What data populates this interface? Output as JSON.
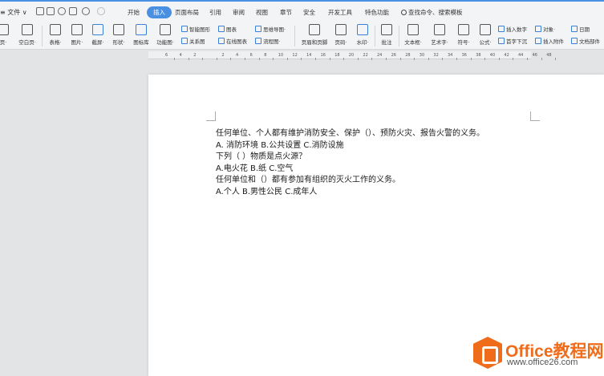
{
  "titlebar": {
    "file_menu": "≡ 文件 ∨",
    "tabs": [
      "开始",
      "插入",
      "页面布局",
      "引用",
      "审阅",
      "视图",
      "章节",
      "安全",
      "开发工具",
      "特色功能"
    ],
    "active_tab": "插入",
    "search_hint": "查找命令、搜索模板"
  },
  "ribbon": {
    "page_btn": "页·",
    "blank_page": "空白页·",
    "table": "表格·",
    "picture": "图片·",
    "screenshot": "截屏·",
    "shape": "形状·",
    "icon_lib": "图标库",
    "func_chart": "功能图·",
    "smart_shape": "智能图形",
    "relation": "关系图",
    "chart": "图表",
    "online_chart": "在线图表",
    "mind_map": "思维导图·",
    "flow_chart": "流程图·",
    "header_footer": "页眉和页脚",
    "page_num": "页码·",
    "watermark": "水印·",
    "comment": "批注",
    "textbox": "文本框·",
    "wordart": "艺术字·",
    "symbol": "符号·",
    "formula": "公式·",
    "insert_number": "插入数字",
    "drop_cap": "首字下沉",
    "object": "对象·",
    "attachment": "插入附件",
    "date": "日期",
    "doc_parts": "文档部件"
  },
  "ruler": {
    "labels": [
      "6",
      "4",
      "2",
      "",
      "2",
      "4",
      "6",
      "8",
      "10",
      "12",
      "14",
      "16",
      "18",
      "20",
      "22",
      "24",
      "26",
      "28",
      "30",
      "32",
      "34",
      "36",
      "38",
      "40",
      "42",
      "44",
      "46",
      "48"
    ]
  },
  "document": {
    "lines": [
      "任何单位、个人都有维护消防安全、保护（）、预防火灾、报告火警的义务。",
      "A.  消防环境    B.公共设置    C.消防设施",
      "下列（ ）物质是点火源？",
      "A.电火花    B.纸    C.空气",
      "任何单位和（）都有参加有组织的灭火工作的义务。",
      "A.个人    B.男性公民    C.成年人"
    ]
  },
  "watermark": {
    "title": "Office教程网",
    "url": "www.office26.com"
  }
}
